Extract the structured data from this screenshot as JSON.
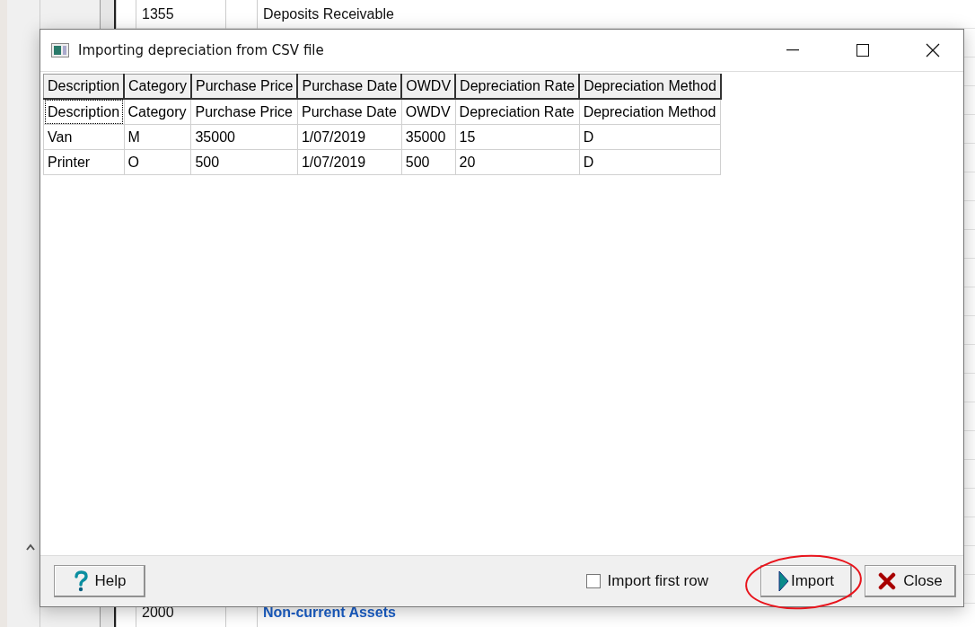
{
  "background": {
    "rows": [
      {
        "number": "1355",
        "name": "Deposits Receivable",
        "kind": "account"
      },
      {
        "number": "2000",
        "name": "Non-current Assets",
        "kind": "heading"
      }
    ]
  },
  "dialog": {
    "title": "Importing depreciation from CSV file",
    "columns": [
      "Description",
      "Category",
      "Purchase Price",
      "Purchase Date",
      "OWDV",
      "Depreciation Rate",
      "Depreciation Method"
    ],
    "rows": [
      {
        "cells": [
          "Description",
          "Category",
          "Purchase Price",
          "Purchase Date",
          "OWDV",
          "Depreciation Rate",
          "Depreciation Method"
        ],
        "focused": true
      },
      {
        "cells": [
          "Van",
          "M",
          "35000",
          "1/07/2019",
          "35000",
          "15",
          "D"
        ],
        "focused": false
      },
      {
        "cells": [
          "Printer",
          "O",
          "500",
          "1/07/2019",
          "500",
          "20",
          "D"
        ],
        "focused": false
      }
    ],
    "checkbox": {
      "label": "Import first row",
      "checked": false
    },
    "buttons": [
      {
        "label": "Help",
        "kind": "help"
      },
      {
        "label": "Import",
        "kind": "import",
        "circled": true
      },
      {
        "label": "Close",
        "kind": "close"
      }
    ]
  }
}
